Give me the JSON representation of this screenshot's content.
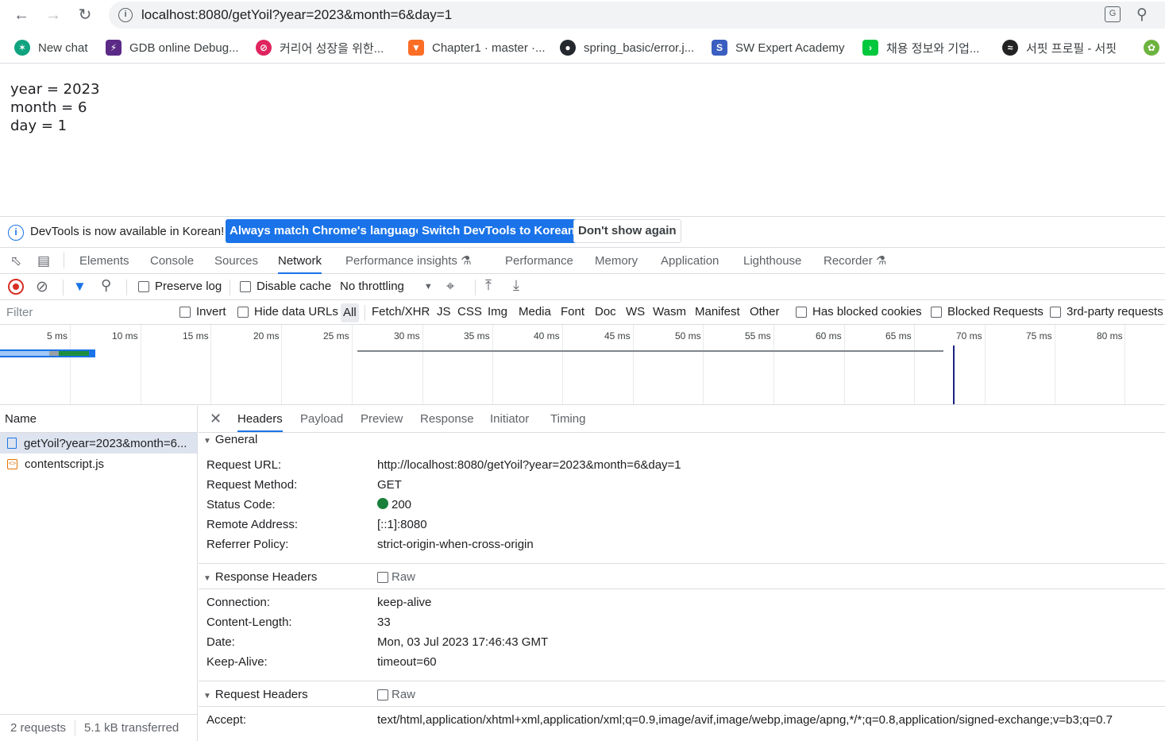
{
  "browser": {
    "url_host": "localhost",
    "url_rest": ":8080/getYoil?year=2023&month=6&day=1",
    "bookmarks": [
      {
        "label": "New chat",
        "icon": "openai-icon",
        "color": "#10a37f"
      },
      {
        "label": "GDB online Debug...",
        "icon": "gdb-icon",
        "color": "#5b2a86"
      },
      {
        "label": "커리어 성장을 위한...",
        "icon": "career-icon",
        "color": "#e0245e"
      },
      {
        "label": "Chapter1 · master ·...",
        "icon": "gitlab-icon",
        "color": "#fc6d26"
      },
      {
        "label": "spring_basic/error.j...",
        "icon": "github-icon",
        "color": "#24292f"
      },
      {
        "label": "SW Expert Academy",
        "icon": "swea-icon",
        "color": "#3b5fc0"
      },
      {
        "label": "채용 정보와 기업...",
        "icon": "jobs-icon",
        "color": "#00c73c"
      },
      {
        "label": "서핏 프로필 - 서핏",
        "icon": "surfit-icon",
        "color": "#222222"
      }
    ]
  },
  "page": {
    "line1": "year = 2023",
    "line2": "month = 6",
    "line3": "day = 1"
  },
  "devtools": {
    "infobar": {
      "message": "DevTools is now available in Korean!",
      "btn_match": "Always match Chrome's language",
      "btn_switch": "Switch DevTools to Korean",
      "btn_dismiss": "Don't show again"
    },
    "tabs": [
      "Elements",
      "Console",
      "Sources",
      "Network",
      "Performance insights",
      "Performance",
      "Memory",
      "Application",
      "Lighthouse",
      "Recorder"
    ],
    "active_tab": "Network",
    "netbar": {
      "preserve_log": "Preserve log",
      "disable_cache": "Disable cache",
      "throttling": "No throttling"
    },
    "filterbar": {
      "placeholder": "Filter",
      "invert": "Invert",
      "hide_data_urls": "Hide data URLs",
      "types": [
        "All",
        "Fetch/XHR",
        "JS",
        "CSS",
        "Img",
        "Media",
        "Font",
        "Doc",
        "WS",
        "Wasm",
        "Manifest",
        "Other"
      ],
      "has_blocked_cookies": "Has blocked cookies",
      "blocked_requests": "Blocked Requests",
      "third_party": "3rd-party requests"
    },
    "timeline_ticks": [
      "5 ms",
      "10 ms",
      "15 ms",
      "20 ms",
      "25 ms",
      "30 ms",
      "35 ms",
      "40 ms",
      "45 ms",
      "50 ms",
      "55 ms",
      "60 ms",
      "65 ms",
      "70 ms",
      "75 ms",
      "80 ms"
    ],
    "requests": {
      "header": "Name",
      "rows": [
        "getYoil?year=2023&month=6...",
        "contentscript.js"
      ],
      "count": "2 requests",
      "transferred": "5.1 kB transferred"
    },
    "detail": {
      "tabs": [
        "Headers",
        "Payload",
        "Preview",
        "Response",
        "Initiator",
        "Timing"
      ],
      "general_title": "General",
      "general": [
        {
          "k": "Request URL:",
          "v": "http://localhost:8080/getYoil?year=2023&month=6&day=1"
        },
        {
          "k": "Request Method:",
          "v": "GET"
        },
        {
          "k": "Status Code:",
          "v": "200"
        },
        {
          "k": "Remote Address:",
          "v": "[::1]:8080"
        },
        {
          "k": "Referrer Policy:",
          "v": "strict-origin-when-cross-origin"
        }
      ],
      "response_title": "Response Headers",
      "raw_label": "Raw",
      "response": [
        {
          "k": "Connection:",
          "v": "keep-alive"
        },
        {
          "k": "Content-Length:",
          "v": "33"
        },
        {
          "k": "Date:",
          "v": "Mon, 03 Jul 2023 17:46:43 GMT"
        },
        {
          "k": "Keep-Alive:",
          "v": "timeout=60"
        }
      ],
      "request_title": "Request Headers",
      "request": [
        {
          "k": "Accept:",
          "v": "text/html,application/xhtml+xml,application/xml;q=0.9,image/avif,image/webp,image/apng,*/*;q=0.8,application/signed-exchange;v=b3;q=0.7"
        }
      ]
    }
  }
}
